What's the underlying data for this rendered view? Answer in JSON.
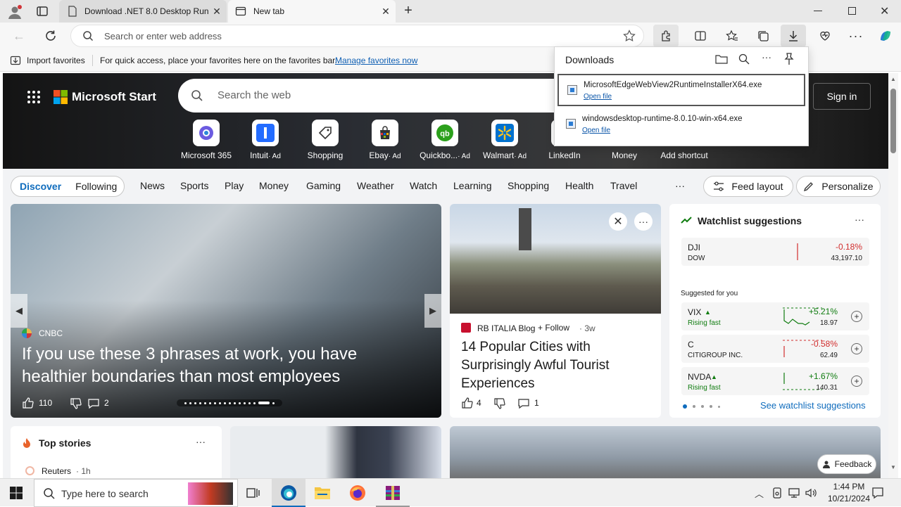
{
  "tabs": [
    {
      "title": "Download .NET 8.0 Desktop Runt"
    },
    {
      "title": "New tab"
    }
  ],
  "omnibox": {
    "placeholder": "Search or enter web address"
  },
  "favbar": {
    "import_label": "Import favorites",
    "hint": "For quick access, place your favorites here on the favorites bar.",
    "manage_link": "Manage favorites now"
  },
  "msstart": {
    "brand": "Microsoft Start",
    "search_placeholder": "Search the web",
    "sign_in": "Sign in",
    "shortcuts": [
      {
        "label": "Microsoft 365",
        "ad": ""
      },
      {
        "label": "Intuit",
        "ad": "· Ad"
      },
      {
        "label": "Shopping",
        "ad": ""
      },
      {
        "label": "Ebay",
        "ad": "· Ad"
      },
      {
        "label": "Quickbo...",
        "ad": "· Ad"
      },
      {
        "label": "Walmart",
        "ad": "· Ad"
      },
      {
        "label": "LinkedIn",
        "ad": ""
      },
      {
        "label": "Money",
        "ad": ""
      },
      {
        "label": "Add shortcut",
        "ad": ""
      }
    ],
    "nav": {
      "discover": "Discover",
      "following": "Following",
      "categories": [
        "News",
        "Sports",
        "Play",
        "Money",
        "Gaming",
        "Weather",
        "Watch",
        "Learning",
        "Shopping",
        "Health",
        "Travel"
      ],
      "more": "···",
      "feed_layout": "Feed layout",
      "personalize": "Personalize"
    }
  },
  "downloads": {
    "title": "Downloads",
    "items": [
      {
        "filename": "MicrosoftEdgeWebView2RuntimeInstallerX64.exe",
        "action": "Open file"
      },
      {
        "filename": "windowsdesktop-runtime-8.0.10-win-x64.exe",
        "action": "Open file"
      }
    ]
  },
  "main_story": {
    "source": "CNBC",
    "headline": "If you use these 3 phrases at work, you have healthier boundaries than most employees",
    "likes": "110",
    "comments": "2"
  },
  "side_story": {
    "source": "RB ITALIA Blog",
    "follow": "Follow",
    "age": "3w",
    "headline": "14 Popular Cities with Surprisingly Awful Tourist Experiences",
    "likes": "4",
    "comments": "1"
  },
  "watchlist": {
    "title": "Watchlist suggestions",
    "top": {
      "symbol": "DJI",
      "name": "DOW",
      "change": "-0.18%",
      "price": "43,197.10"
    },
    "suggested_label": "Suggested for you",
    "items": [
      {
        "symbol": "VIX",
        "sub": "Rising fast",
        "change": "+5.21%",
        "price": "18.97",
        "dir": "pos"
      },
      {
        "symbol": "C",
        "sub": "CITIGROUP INC.",
        "change": "-0.58%",
        "price": "62.49",
        "dir": "neg"
      },
      {
        "symbol": "NVDA",
        "sub": "Rising fast",
        "change": "+1.67%",
        "price": "140.31",
        "dir": "pos"
      }
    ],
    "see_more": "See watchlist suggestions"
  },
  "top_stories": {
    "title": "Top stories",
    "source": "Reuters",
    "age": "1h"
  },
  "feedback": "Feedback",
  "taskbar": {
    "search_placeholder": "Type here to search",
    "time": "1:44 PM",
    "date": "10/21/2024"
  },
  "colors": {
    "accent": "#0f6cbd",
    "negative": "#d12d2d",
    "positive": "#107c10"
  }
}
